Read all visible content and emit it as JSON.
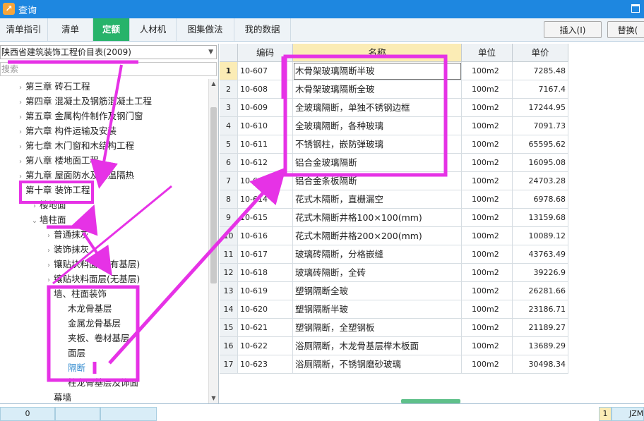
{
  "window": {
    "title": "查询",
    "app_icon": "app-logo-icon"
  },
  "tabs": [
    {
      "label": "清单指引"
    },
    {
      "label": "清单"
    },
    {
      "label": "定额",
      "active": true
    },
    {
      "label": "人材机"
    },
    {
      "label": "图集做法"
    },
    {
      "label": "我的数据"
    }
  ],
  "actions": {
    "insert": "插入(I)",
    "replace": "替换("
  },
  "left": {
    "library": "陕西省建筑装饰工程价目表(2009)",
    "search_placeholder": "搜索",
    "tree": [
      {
        "label": "第三章 砖石工程",
        "expand": "collapsed"
      },
      {
        "label": "第四章 混凝土及钢筋混凝土工程",
        "expand": "collapsed"
      },
      {
        "label": "第五章 金属构件制作及钢门窗",
        "expand": "collapsed"
      },
      {
        "label": "第六章 构件运输及安装",
        "expand": "collapsed"
      },
      {
        "label": "第七章 木门窗和木结构工程",
        "expand": "collapsed"
      },
      {
        "label": "第八章 楼地面工程",
        "expand": "collapsed"
      },
      {
        "label": "第九章 屋面防水及保温隔热",
        "expand": "collapsed"
      },
      {
        "label": "第十章 装饰工程",
        "expand": "expanded"
      },
      {
        "label": "楼地面",
        "expand": "collapsed"
      },
      {
        "label": "墙柱面",
        "expand": "expanded"
      },
      {
        "label": "普通抹灰",
        "expand": "collapsed"
      },
      {
        "label": "装饰抹灰",
        "expand": "collapsed"
      },
      {
        "label": "镶贴块料面层(有基层)",
        "expand": "collapsed"
      },
      {
        "label": "镶贴块料面层(无基层)",
        "expand": "collapsed"
      },
      {
        "label": "墙、柱面装饰",
        "expand": "expanded"
      },
      {
        "label": "木龙骨基层",
        "expand": "none"
      },
      {
        "label": "金属龙骨基层",
        "expand": "none"
      },
      {
        "label": "夹板、卷材基层",
        "expand": "none"
      },
      {
        "label": "面层",
        "expand": "none"
      },
      {
        "label": "隔断",
        "expand": "none",
        "selected": true
      },
      {
        "label": "柱龙骨基层及饰面",
        "expand": "none"
      },
      {
        "label": "幕墙",
        "expand": "none"
      }
    ]
  },
  "grid": {
    "columns": {
      "index": "",
      "code": "编码",
      "name": "名称",
      "unit": "单位",
      "price": "单价"
    },
    "rows": [
      {
        "idx": "1",
        "code": "10-607",
        "name": "木骨架玻璃隔断半玻",
        "unit": "100m2",
        "price": "7285.48",
        "selected": true
      },
      {
        "idx": "2",
        "code": "10-608",
        "name": "木骨架玻璃隔断全玻",
        "unit": "100m2",
        "price": "7167.4"
      },
      {
        "idx": "3",
        "code": "10-609",
        "name": "全玻璃隔断，单独不锈钢边框",
        "unit": "100m2",
        "price": "17244.95"
      },
      {
        "idx": "4",
        "code": "10-610",
        "name": "全玻璃隔断，各种玻璃",
        "unit": "100m2",
        "price": "7091.73"
      },
      {
        "idx": "5",
        "code": "10-611",
        "name": "不锈钢柱，嵌防弹玻璃",
        "unit": "100m2",
        "price": "65595.62"
      },
      {
        "idx": "6",
        "code": "10-612",
        "name": "铝合金玻璃隔断",
        "unit": "100m2",
        "price": "16095.08"
      },
      {
        "idx": "7",
        "code": "10-613",
        "name": "铝合金条板隔断",
        "unit": "100m2",
        "price": "24703.28"
      },
      {
        "idx": "8",
        "code": "10-614",
        "name": "花式木隔断，直栅漏空",
        "unit": "100m2",
        "price": "6978.68"
      },
      {
        "idx": "9",
        "code": "10-615",
        "name": "花式木隔断井格100×100(mm)",
        "unit": "100m2",
        "price": "13159.68"
      },
      {
        "idx": "10",
        "code": "10-616",
        "name": "花式木隔断井格200×200(mm)",
        "unit": "100m2",
        "price": "10089.12"
      },
      {
        "idx": "11",
        "code": "10-617",
        "name": "玻璃砖隔断，分格嵌缝",
        "unit": "100m2",
        "price": "43763.49"
      },
      {
        "idx": "12",
        "code": "10-618",
        "name": "玻璃砖隔断，全砖",
        "unit": "100m2",
        "price": "39226.9"
      },
      {
        "idx": "13",
        "code": "10-619",
        "name": "塑钢隔断全玻",
        "unit": "100m2",
        "price": "26281.66"
      },
      {
        "idx": "14",
        "code": "10-620",
        "name": "塑钢隔断半玻",
        "unit": "100m2",
        "price": "23186.71"
      },
      {
        "idx": "15",
        "code": "10-621",
        "name": "塑钢隔断，全塑钢板",
        "unit": "100m2",
        "price": "21189.27"
      },
      {
        "idx": "16",
        "code": "10-622",
        "name": "浴厕隔断，木龙骨基层榉木板面",
        "unit": "100m2",
        "price": "13689.29"
      },
      {
        "idx": "17",
        "code": "10-623",
        "name": "浴厕隔断，不锈钢磨砂玻璃",
        "unit": "100m2",
        "price": "30498.34"
      }
    ]
  },
  "bottom": {
    "value": "0",
    "row_num": "1",
    "code_cell": "JZM"
  },
  "colors": {
    "titlebar": "#1e87e0",
    "active_tab": "#27b36a",
    "annotation": "#e632e6",
    "selected_tree_text": "#3a8fd0"
  }
}
